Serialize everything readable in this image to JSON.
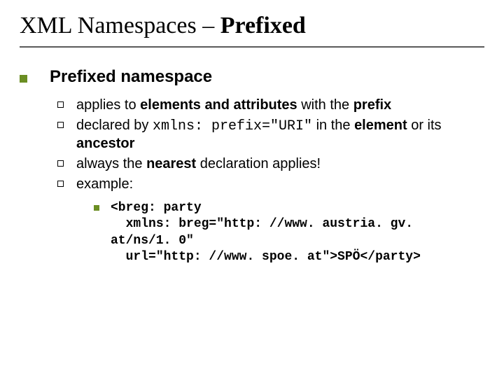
{
  "title_plain": "XML Namespaces – ",
  "title_bold": "Prefixed",
  "heading": "Prefixed namespace",
  "bullets": [
    {
      "pre": "applies to ",
      "b1": "elements and attributes ",
      "mid": "with the ",
      "b2": "prefix"
    },
    {
      "pre": "declared by ",
      "code": "xmlns: prefix=\"URI\"",
      "mid": " in the ",
      "b1": "element",
      "post1": " or its ",
      "b2": "ancestor"
    },
    {
      "pre": "always the ",
      "b1": "nearest ",
      "post": "declaration applies!"
    },
    {
      "pre": "example:"
    }
  ],
  "code_example": "<breg: party\n  xmlns: breg=\"http: //www. austria. gv. at/ns/1. 0\"\n  url=\"http: //www. spoe. at\">SPÖ</party>"
}
